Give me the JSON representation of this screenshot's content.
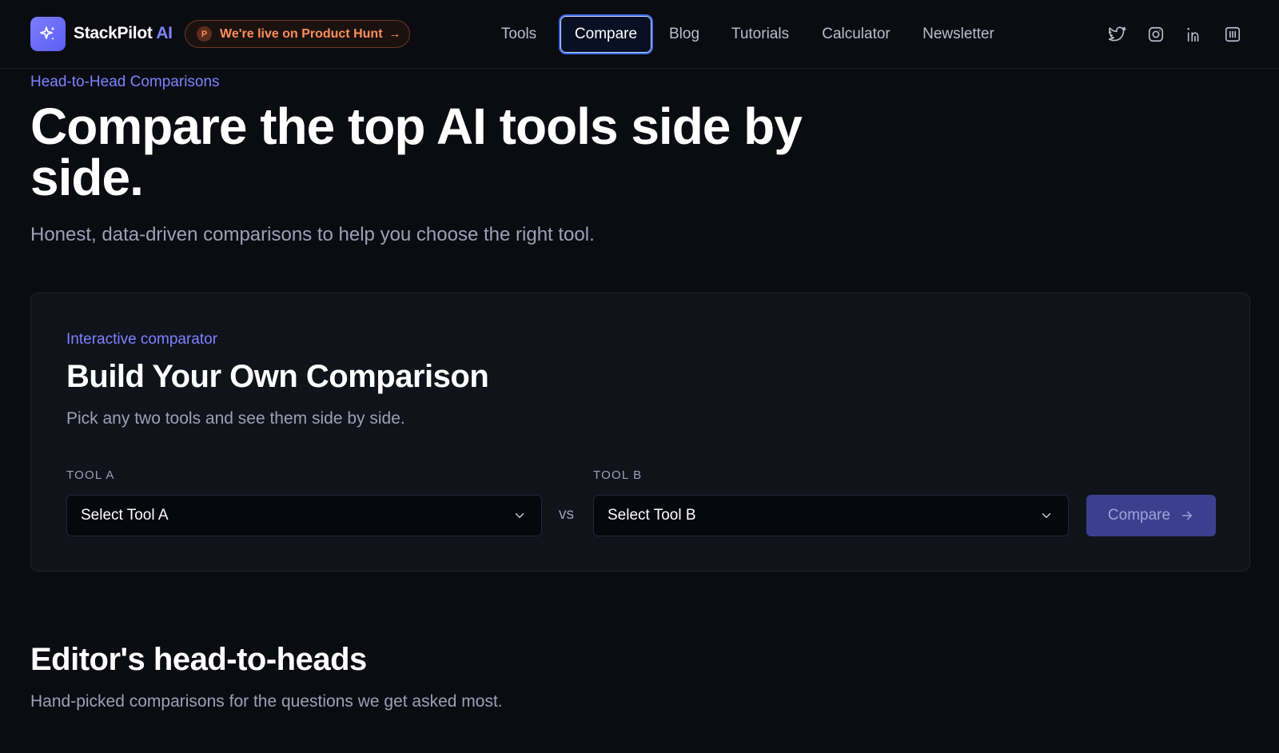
{
  "header": {
    "brand_name": "StackPilot",
    "brand_accent": "AI",
    "product_hunt": {
      "badge_letter": "P",
      "label": "We're live on Product Hunt",
      "arrow": "→"
    },
    "nav": [
      {
        "label": "Tools",
        "active": false
      },
      {
        "label": "Compare",
        "active": true
      },
      {
        "label": "Blog",
        "active": false
      },
      {
        "label": "Tutorials",
        "active": false
      },
      {
        "label": "Calculator",
        "active": false
      },
      {
        "label": "Newsletter",
        "active": false
      }
    ],
    "social_icons": [
      "twitter-icon",
      "instagram-icon",
      "linkedin-icon",
      "product-hunt-icon"
    ]
  },
  "hero": {
    "eyebrow": "Head-to-Head Comparisons",
    "title": "Compare the top AI tools side by side.",
    "subtitle": "Honest, data-driven comparisons to help you choose the right tool."
  },
  "comparator": {
    "eyebrow": "Interactive comparator",
    "title": "Build Your Own Comparison",
    "subtitle": "Pick any two tools and see them side by side.",
    "tool_a": {
      "label": "TOOL A",
      "value": "Select Tool A"
    },
    "tool_b": {
      "label": "TOOL B",
      "value": "Select Tool B"
    },
    "vs": "vs",
    "button_label": "Compare"
  },
  "editors": {
    "title": "Editor's head-to-heads",
    "subtitle": "Hand-picked comparisons for the questions we get asked most."
  },
  "colors": {
    "background": "#0b0c12",
    "accent": "#7b83ff",
    "product_hunt": "#ff8e5a",
    "card": "#11131b"
  }
}
